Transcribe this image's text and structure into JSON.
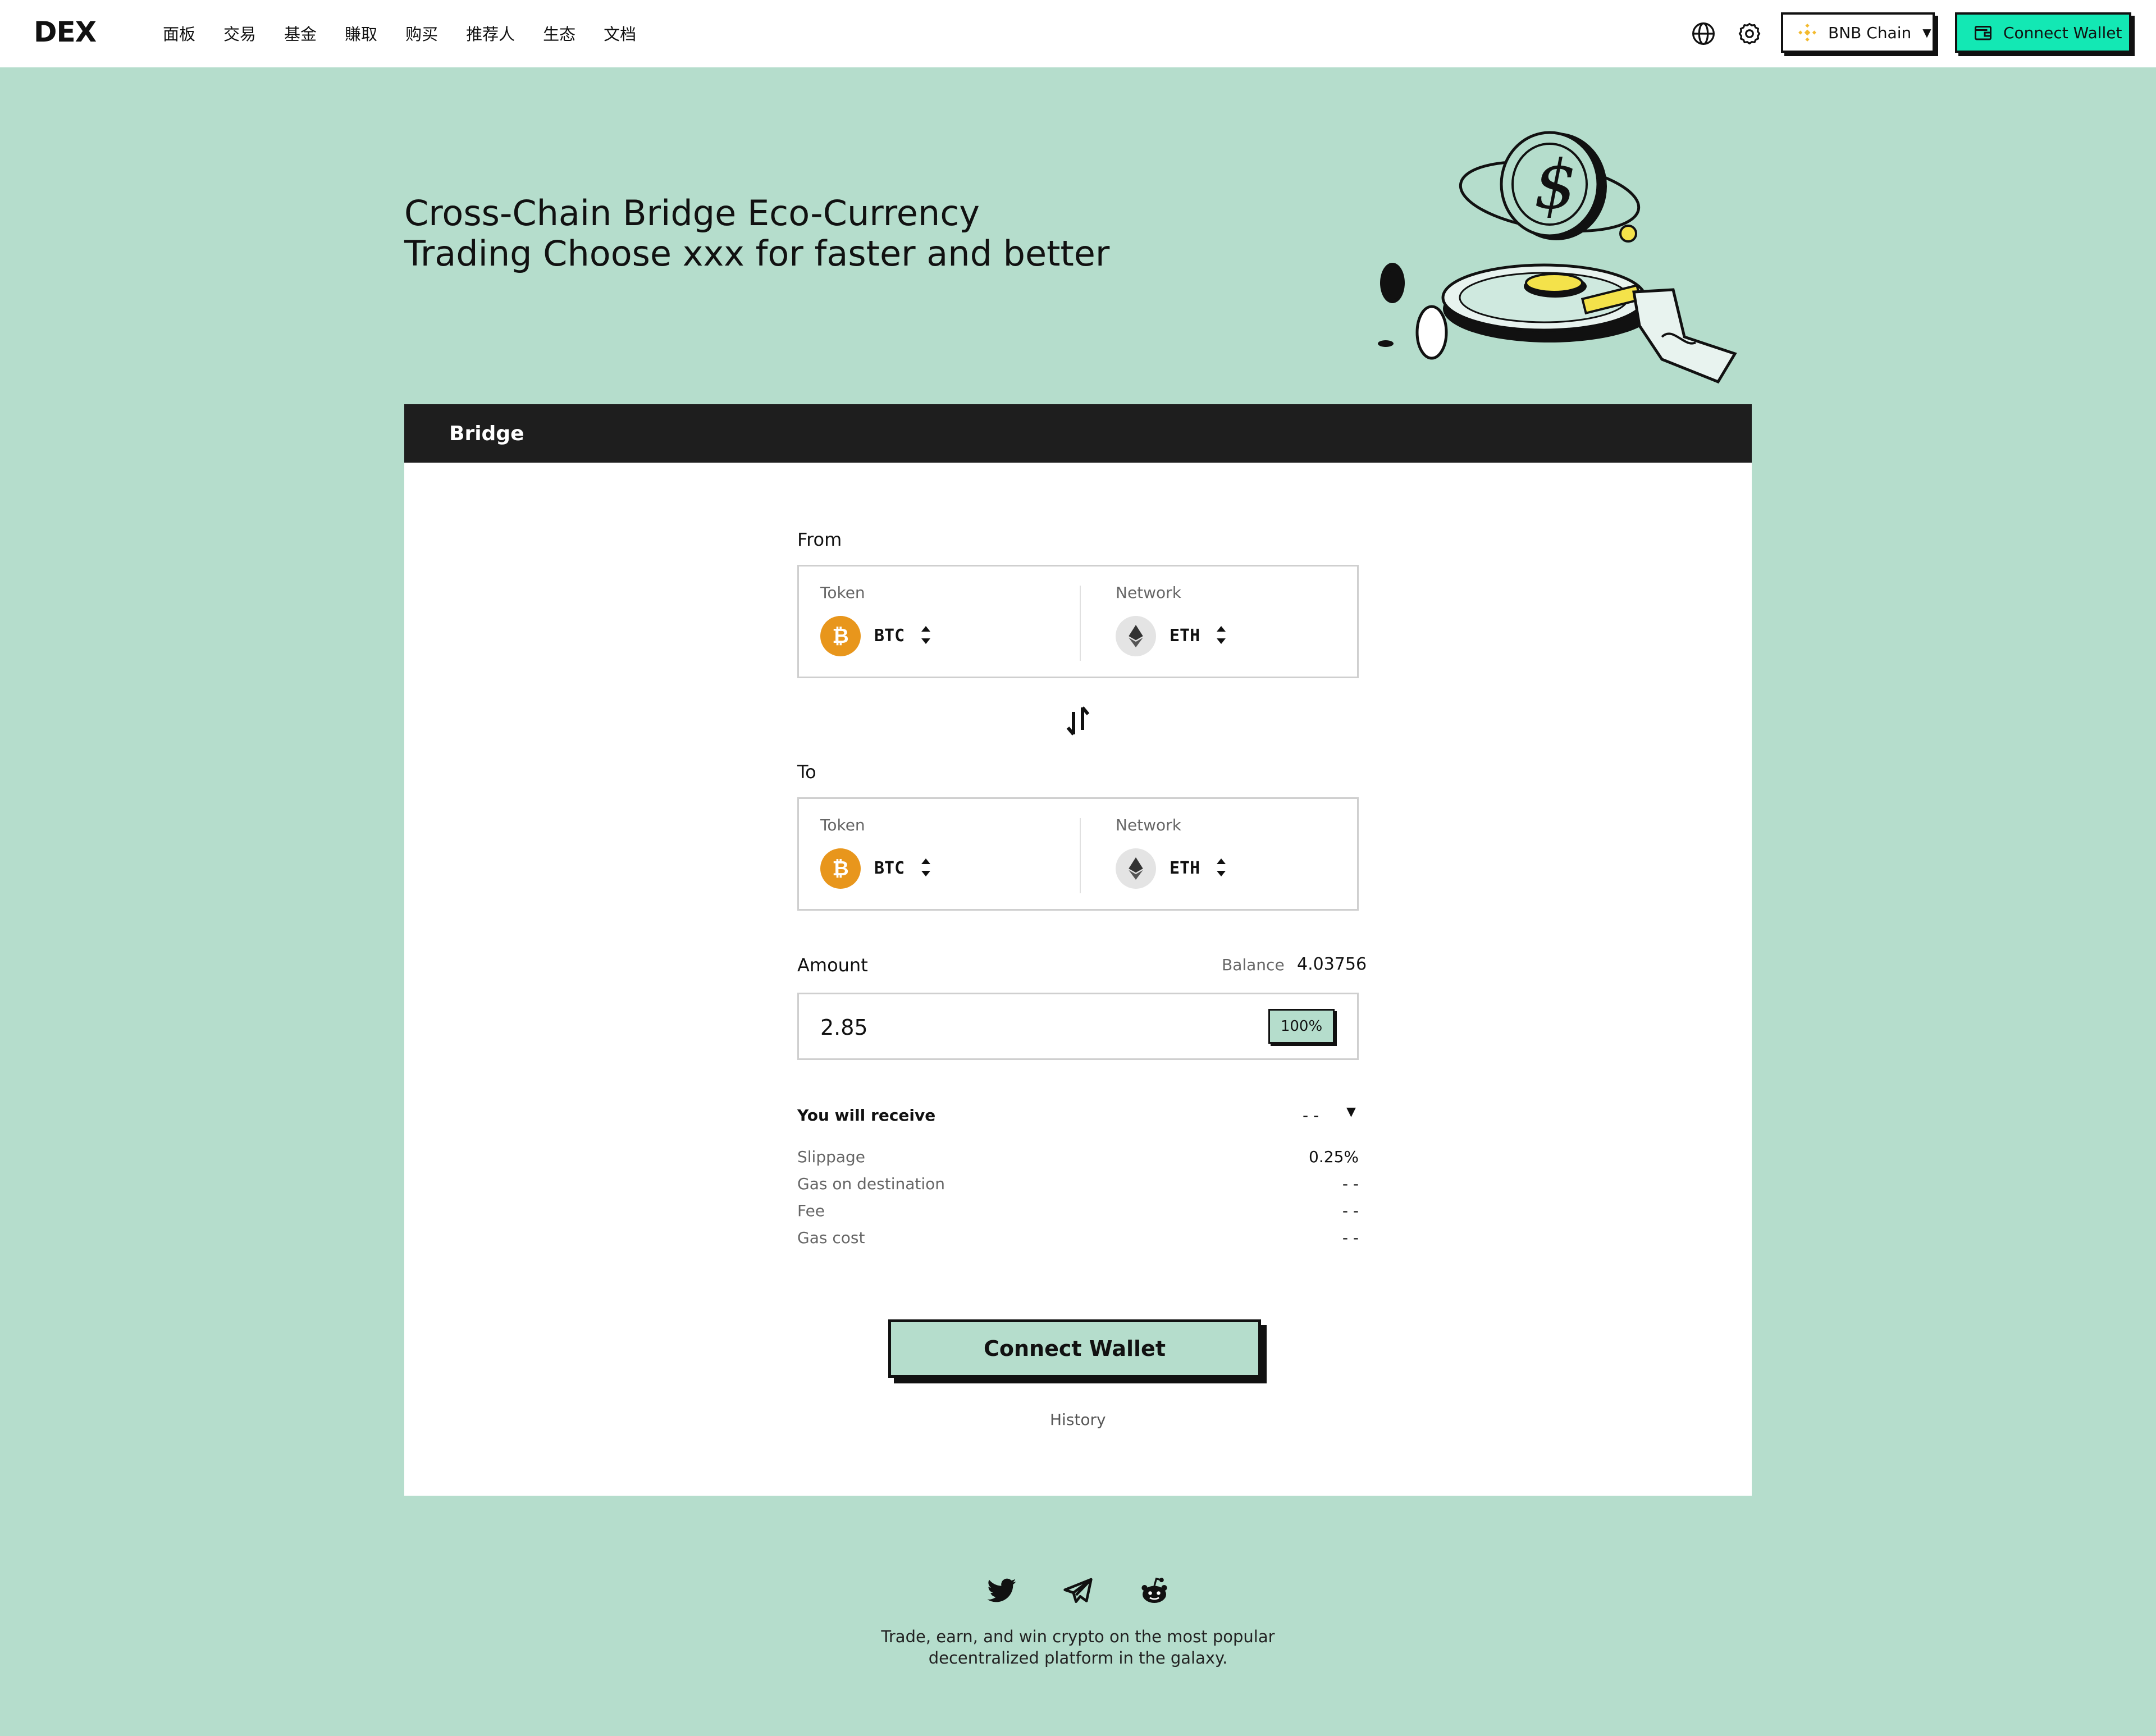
{
  "header": {
    "logo": "DEX",
    "nav": [
      "面板",
      "交易",
      "基金",
      "賺取",
      "购买",
      "推荐人",
      "生态",
      "文档"
    ],
    "chain_label": "BNB Chain",
    "wallet_label": "Connect Wallet"
  },
  "hero": {
    "line1": "Cross-Chain Bridge Eco-Currency",
    "line2": "Trading Choose xxx for faster and better"
  },
  "card": {
    "title": "Bridge",
    "from": {
      "label": "From",
      "token_label": "Token",
      "token": "BTC",
      "network_label": "Network",
      "network": "ETH"
    },
    "to": {
      "label": "To",
      "token_label": "Token",
      "token": "BTC",
      "network_label": "Network",
      "network": "ETH"
    },
    "amount": {
      "label": "Amount",
      "balance_label": "Balance",
      "balance": "4.03756",
      "value": "2.85",
      "pct_button": "100%"
    },
    "receive": {
      "label": "You will receive",
      "value": "- -"
    },
    "details": [
      {
        "k": "Slippage",
        "v": "0.25%"
      },
      {
        "k": "Gas on destination",
        "v": "- -"
      },
      {
        "k": "Fee",
        "v": "- -"
      },
      {
        "k": "Gas cost",
        "v": "- -"
      }
    ],
    "cta": "Connect Wallet",
    "history": "History"
  },
  "footer": {
    "social": [
      "twitter-icon",
      "telegram-icon",
      "reddit-icon"
    ],
    "line1": "Trade, earn, and win crypto on the most popular",
    "line2": "decentralized platform in the galaxy."
  },
  "colors": {
    "background": "#b5ddcc",
    "accent": "#13e8b4",
    "dark": "#1e1e1e",
    "btc": "#e8961c",
    "bnb": "#f3ba2f"
  }
}
